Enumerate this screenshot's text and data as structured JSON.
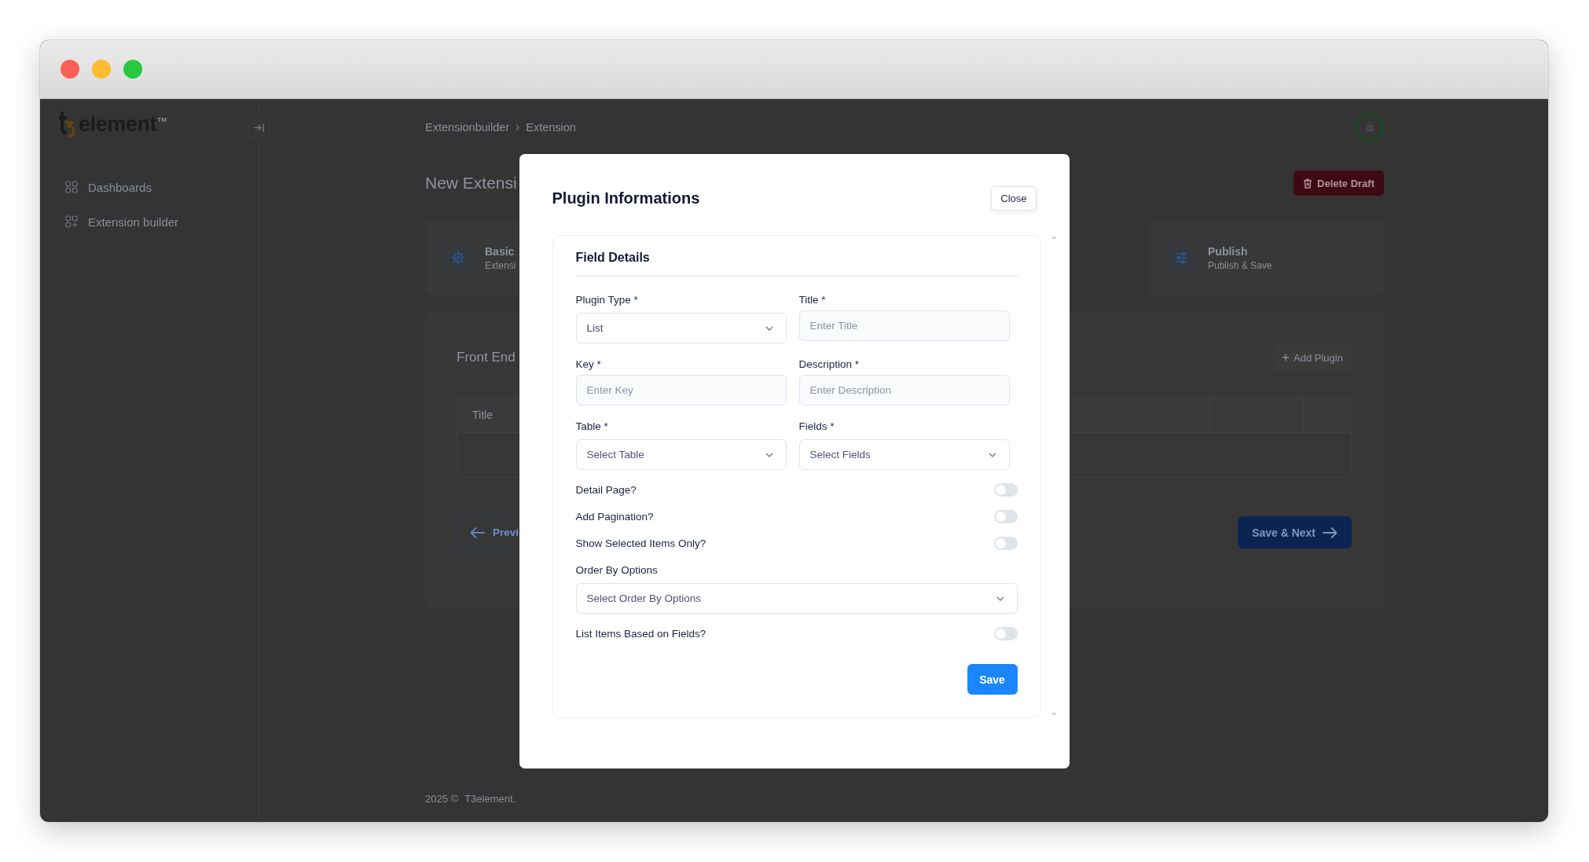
{
  "window": {
    "controls": [
      {
        "color": "#fe5f57"
      },
      {
        "color": "#febc2e"
      },
      {
        "color": "#28c840"
      }
    ]
  },
  "sidebar": {
    "logo": {
      "text": "element",
      "trademark": "TM"
    },
    "items": [
      {
        "kind": "dashboard",
        "label": "Dashboards",
        "selected": false
      },
      {
        "kind": "builder",
        "label": "Extension builder",
        "selected": false
      }
    ]
  },
  "topbar": {
    "breadcrumb": [
      "Extensionbuilder",
      "Extension"
    ]
  },
  "page": {
    "title": "New Extensi",
    "delete_label": "Delete Draft",
    "steps": [
      {
        "kind": "basic",
        "title": "Basic",
        "subtitle": "Extensi"
      },
      {
        "kind": "publish",
        "title": "Publish",
        "subtitle": "Publish & Save"
      }
    ],
    "section": {
      "title": "Front End",
      "add_label": "Add Plugin",
      "table": {
        "columns": [
          "Title"
        ]
      }
    },
    "previous_label": "Previ",
    "next_label": "Save & Next"
  },
  "footer": {
    "copyright": "2025 ©",
    "link": "T3element."
  },
  "modal": {
    "title": "Plugin Informations",
    "close_label": "Close",
    "section": {
      "title": "Field Details",
      "fields": [
        {
          "kind": "select",
          "label": "Plugin Type *",
          "value": "List"
        },
        {
          "kind": "text",
          "label": "Title *",
          "placeholder": "Enter Title"
        },
        {
          "kind": "text",
          "label": "Key *",
          "placeholder": "Enter Key"
        },
        {
          "kind": "text",
          "label": "Description *",
          "placeholder": "Enter Description"
        },
        {
          "kind": "select",
          "label": "Table *",
          "placeholder": "Select Table"
        },
        {
          "kind": "select",
          "label": "Fields *",
          "placeholder": "Select Fields"
        }
      ],
      "options": [
        {
          "kind": "toggle",
          "label": "Detail Page?",
          "on": false
        },
        {
          "kind": "toggle",
          "label": "Add Pagination?",
          "on": false
        },
        {
          "kind": "toggle",
          "label": "Show Selected Items Only?",
          "on": false
        },
        {
          "kind": "select",
          "label": "Order By Options",
          "placeholder": "Select Order By Options"
        },
        {
          "kind": "toggle",
          "label": "List Items Based on Fields?",
          "on": false
        }
      ],
      "save_label": "Save"
    }
  }
}
